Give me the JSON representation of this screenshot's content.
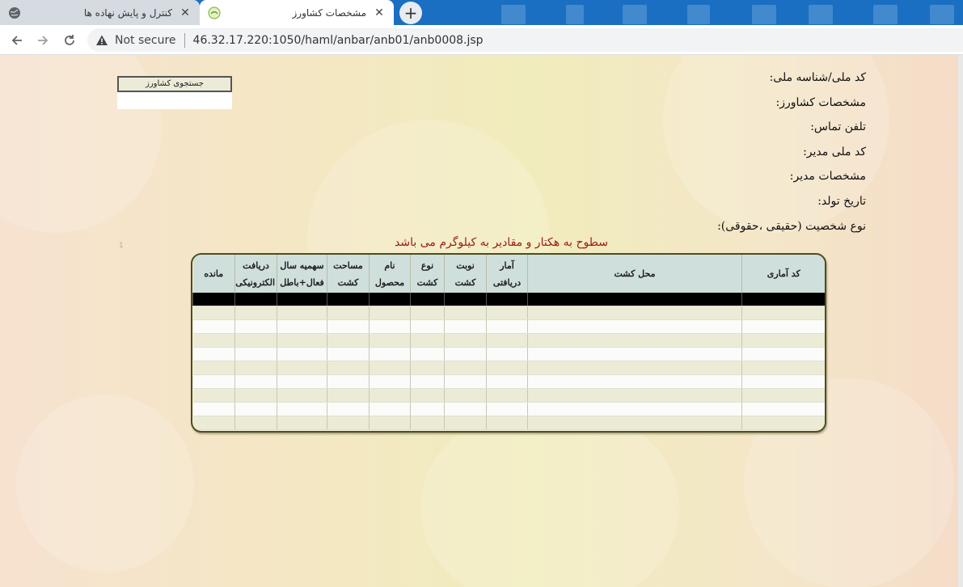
{
  "browser": {
    "tabs": [
      {
        "title": "کنترل و پایش نهاده ها",
        "active": false,
        "icon": "globe-icon"
      },
      {
        "title": "مشخصات کشاورز",
        "active": true,
        "icon": "site-logo-icon"
      }
    ],
    "address": {
      "security_label": "Not secure",
      "url": "46.32.17.220:1050/haml/anbar/anb01/anb0008.jsp"
    }
  },
  "page": {
    "info_labels": [
      "کد ملی/شناسه ملی:",
      "مشخصات کشاورز:",
      "تلفن تماس:",
      "کد ملی مدیر:",
      "مشخصات مدیر:",
      "تاریخ تولد:",
      "نوع شخصیت (حقیقی ،حقوقی):"
    ],
    "search_button_label": "جستجوی کشاورز",
    "search_input_value": "",
    "tiny_marker": "1",
    "note": "سطوح به هکتار و مقادیر به کیلوگرم می باشد",
    "table": {
      "columns": [
        [
          "کد آماری"
        ],
        [
          "محل کشت"
        ],
        [
          "آمار",
          "دریافتی"
        ],
        [
          "نوبت",
          "کشت"
        ],
        [
          "نوع",
          "کشت"
        ],
        [
          "نام",
          "محصول"
        ],
        [
          "مساحت",
          "کشت"
        ],
        [
          "سهمیه سال",
          "فعال+باطل"
        ],
        [
          "دریافت",
          "الکترونیکی"
        ],
        [
          "مانده"
        ]
      ],
      "row_count": 9
    }
  },
  "colors": {
    "tabstrip": "#1a6fc3",
    "note_text": "#9a1d12",
    "grid_header": "#cfdfdc",
    "grid_border": "#4d4d1e"
  }
}
